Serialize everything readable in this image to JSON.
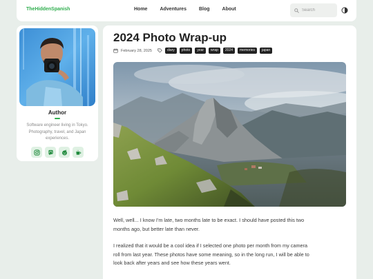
{
  "header": {
    "brand": "TheHiddenSpanish",
    "nav": [
      "Home",
      "Adventures",
      "Blog",
      "About"
    ],
    "search_placeholder": "Search"
  },
  "sidebar": {
    "author_name": "Author",
    "author_bio": "Software engineer living in Tokyo. Photography, travel, and Japan experiences.",
    "socials": [
      "instagram-icon",
      "mastodon-icon",
      "reddit-icon",
      "coffee-icon"
    ]
  },
  "post": {
    "title": "2024 Photo Wrap-up",
    "date": "February 28, 2025",
    "tags": [
      "diary",
      "photo",
      "year",
      "wrap",
      "2024",
      "memories",
      "japan"
    ],
    "paragraphs": [
      "Well, well... I know I'm late, two months late to be exact. I should have posted this two months ago, but better late than never.",
      "I realized that it would be a cool idea if I selected one photo per month from my camera roll from last year. These photos have some meaning, so in the long run, I will be able to look back after years and see how these years went."
    ]
  },
  "colors": {
    "accent": "#2fae4e",
    "page_bg": "#e8eeea",
    "card_bg": "#ffffff",
    "tag_bg": "#222222"
  }
}
